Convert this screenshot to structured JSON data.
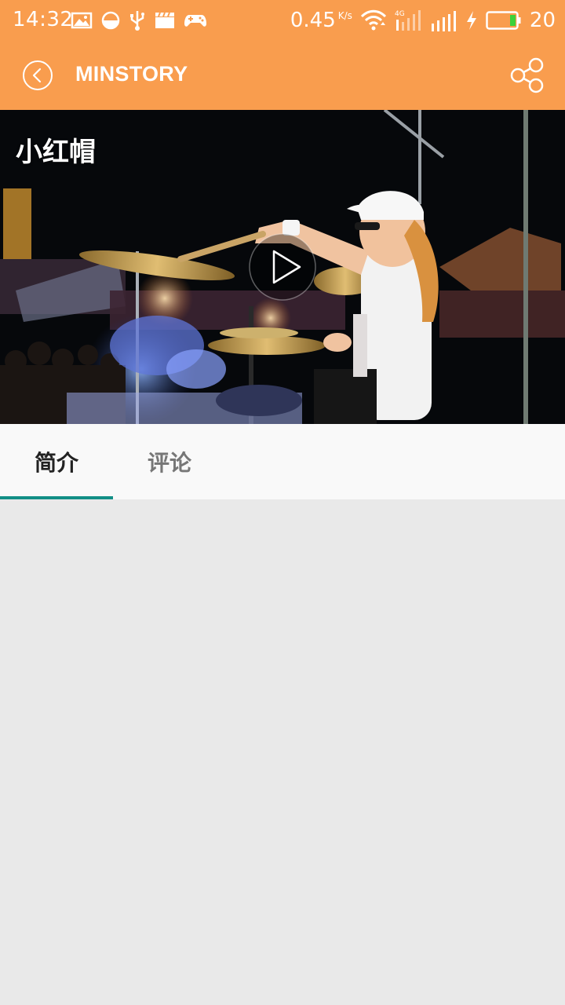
{
  "status_bar": {
    "time": "14:32",
    "net_speed": "0.45",
    "net_unit": "K/s",
    "network_type": "4G",
    "battery_level": "20",
    "icons": [
      "image-icon",
      "data-saver-icon",
      "usb-icon",
      "clapperboard-icon",
      "gamepad-icon",
      "wifi-icon",
      "signal-4g-icon",
      "signal-icon",
      "charging-icon",
      "battery-icon"
    ]
  },
  "app_bar": {
    "title": "MINSTORY",
    "back_icon": "back-circle-icon",
    "share_icon": "share-icon"
  },
  "video": {
    "title": "小红帽",
    "play_icon": "play-icon"
  },
  "tabs": [
    {
      "label": "简介",
      "active": true
    },
    {
      "label": "评论",
      "active": false
    }
  ],
  "colors": {
    "accent": "#f99d4e",
    "tab_indicator": "#138f86",
    "background": "#e9e9e9"
  }
}
